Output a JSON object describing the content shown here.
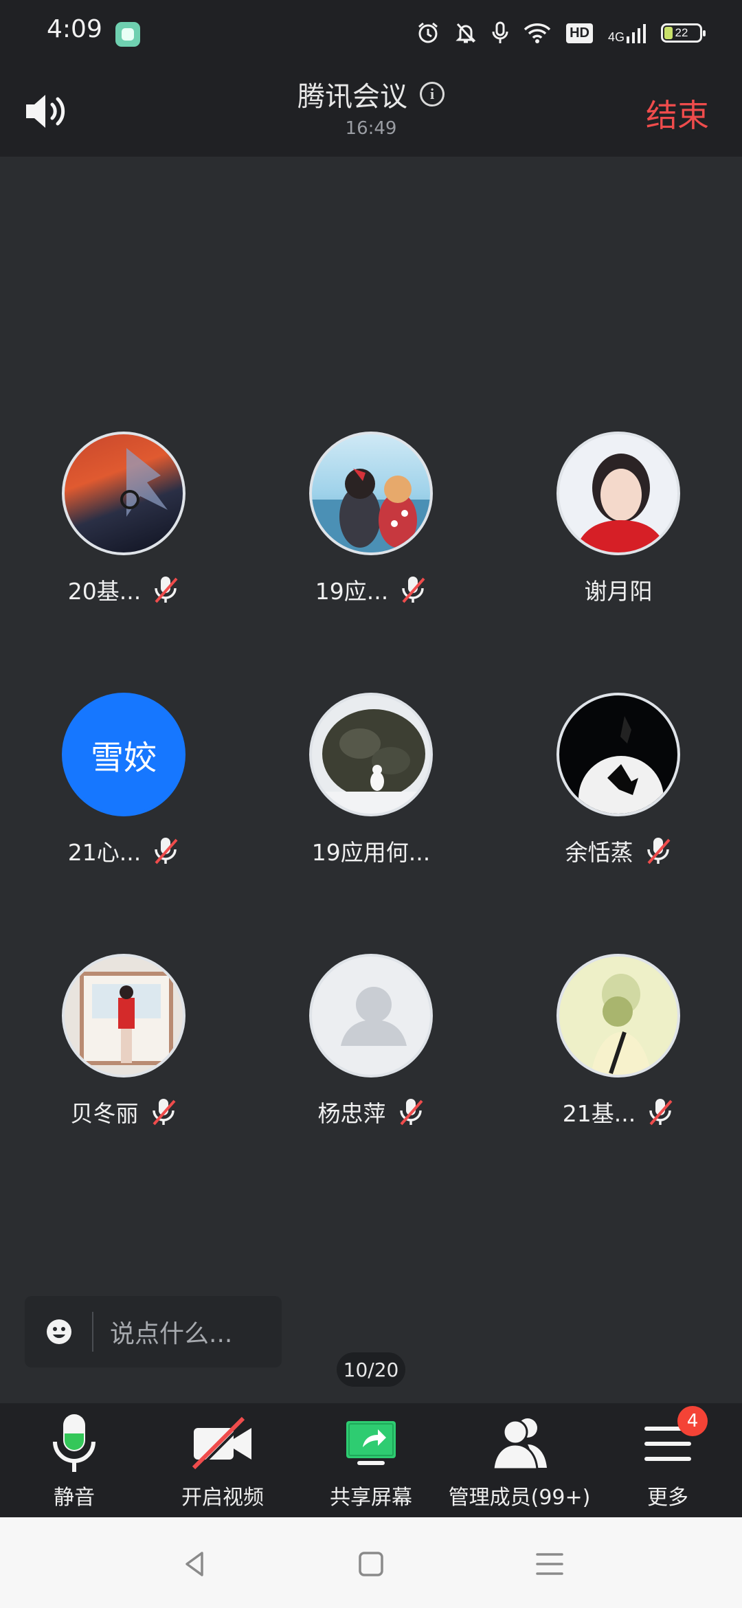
{
  "status_bar": {
    "time": "4:09",
    "hd_label": "HD",
    "network_label": "4G",
    "battery_level": "22"
  },
  "header": {
    "title": "腾讯会议",
    "duration": "16:49",
    "end_label": "结束"
  },
  "participants": [
    {
      "name": "20基...",
      "muted": true,
      "avatar_text": ""
    },
    {
      "name": "19应...",
      "muted": true,
      "avatar_text": ""
    },
    {
      "name": "谢月阳",
      "muted": false,
      "avatar_text": ""
    },
    {
      "name": "21心...",
      "muted": true,
      "avatar_text": "雪姣"
    },
    {
      "name": "19应用何...",
      "muted": false,
      "avatar_text": ""
    },
    {
      "name": "余恬蒸",
      "muted": true,
      "avatar_text": ""
    },
    {
      "name": "贝冬丽",
      "muted": true,
      "avatar_text": ""
    },
    {
      "name": "杨忠萍",
      "muted": true,
      "avatar_text": ""
    },
    {
      "name": "21基...",
      "muted": true,
      "avatar_text": ""
    }
  ],
  "chat": {
    "placeholder": "说点什么..."
  },
  "page_indicator": "10/20",
  "toolbar": {
    "mute_label": "静音",
    "video_label": "开启视频",
    "share_label": "共享屏幕",
    "members_label": "管理成员(99+)",
    "more_label": "更多",
    "more_badge": "4"
  },
  "colors": {
    "end_red": "#ef4c4c",
    "avatar_blue": "#1677ff",
    "mic_green": "#34c759",
    "share_green": "#2ecc71"
  }
}
